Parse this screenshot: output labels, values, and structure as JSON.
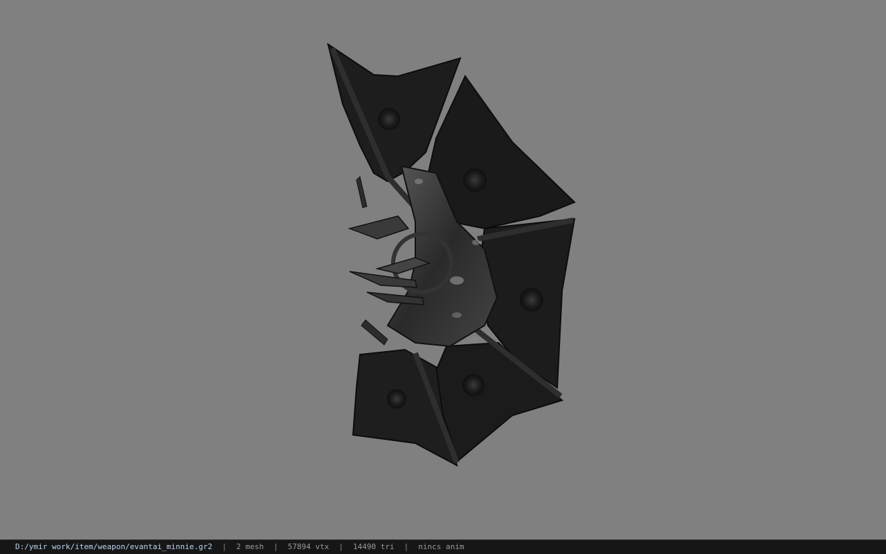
{
  "viewer": {
    "background_color": "#808080",
    "model_icon": "fan-weapon-3d-model"
  },
  "statusbar": {
    "file_path": "D:/ymir work/item/weapon/evantai_minnie.gr2",
    "separator": "|",
    "mesh_count": "2 mesh",
    "vertex_count": "57894 vtx",
    "triangle_count": "14490 tri",
    "anim_status": "nincs anim"
  }
}
